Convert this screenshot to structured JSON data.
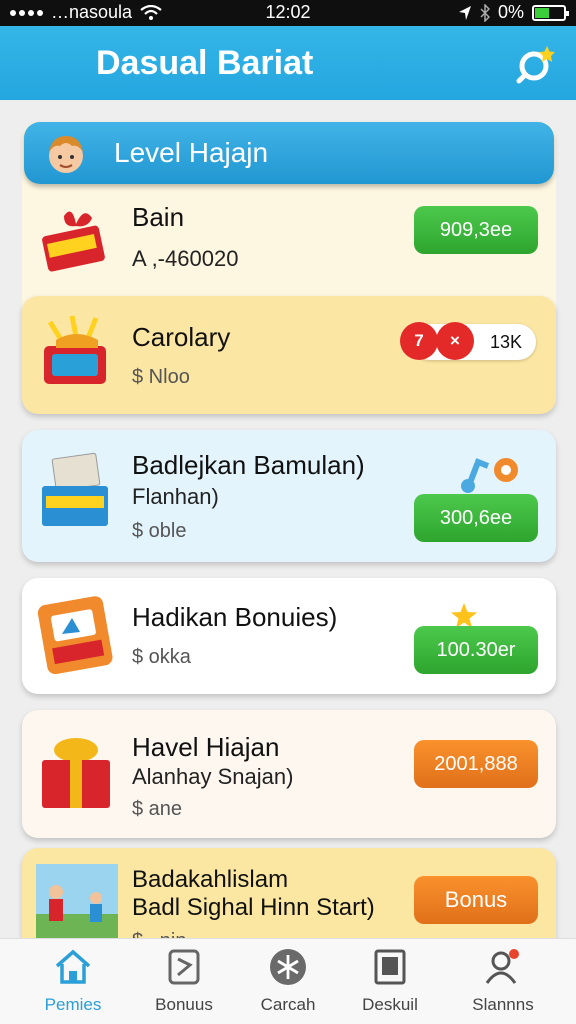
{
  "status": {
    "carrier": "…nasoula",
    "time": "12:02",
    "battery": "0%",
    "battery_level": 0.5
  },
  "header": {
    "title": "Dasual Bariat",
    "search_icon": "search-icon"
  },
  "level_header": {
    "label": "Level Hajajn"
  },
  "items": [
    {
      "title": "Bain",
      "line2": "A ,-460020",
      "value": "909,3ee"
    },
    {
      "title": "Carolary",
      "line3": "$ Nloo",
      "counter_a": "7",
      "counter_b": "×",
      "counter_value": "13K"
    },
    {
      "title": "Badlejkan Bamulan)",
      "line2": "Flanhan)",
      "line3": "$ oble",
      "value": "300,6ee"
    },
    {
      "title": "Hadikan Bonuies)",
      "line3": "$ okka",
      "value": "100.30er"
    },
    {
      "title": "Havel Hiajan",
      "line2": "Alanhay Snajan)",
      "line3": "$ ane",
      "value": "2001,888"
    },
    {
      "title": "Badakahlislam",
      "line2": "Badl Sighal Hinn Start)",
      "line3": "$ ..nin",
      "value": "Bonus"
    }
  ],
  "nav": [
    {
      "label": "Pemies",
      "icon": "home-icon",
      "active": true
    },
    {
      "label": "Bonuus",
      "icon": "bonus-icon",
      "active": false
    },
    {
      "label": "Carcah",
      "icon": "snowflake-icon",
      "active": false
    },
    {
      "label": "Deskuil",
      "icon": "document-icon",
      "active": false
    },
    {
      "label": "Slannns",
      "icon": "profile-icon",
      "active": false
    }
  ],
  "colors": {
    "brand": "#24a6df",
    "green": "#36b336",
    "orange": "#ee7f22",
    "red": "#e42a28"
  }
}
